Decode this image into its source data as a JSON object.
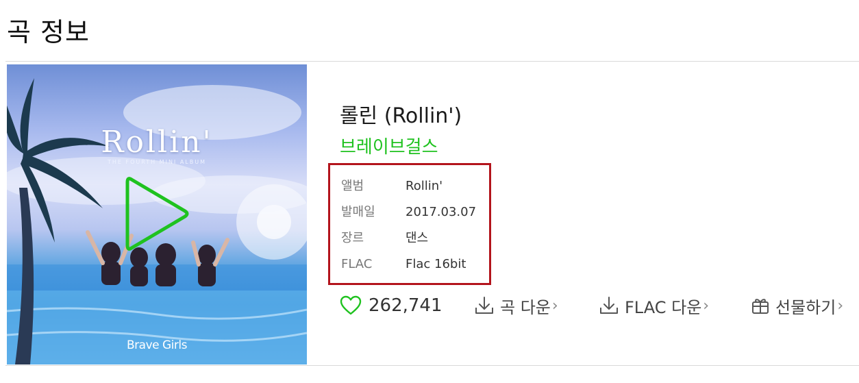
{
  "section": {
    "title": "곡 정보"
  },
  "album_art": {
    "title_text": "Rollin'",
    "subtitle_text": "THE FOURTH MINI ALBUM",
    "artist_text": "Brave Girls",
    "play_icon": "play-icon"
  },
  "song": {
    "title": "롤린 (Rollin')",
    "artist": "브레이브걸스"
  },
  "meta": [
    {
      "key": "앨범",
      "value": "Rollin'"
    },
    {
      "key": "발매일",
      "value": "2017.03.07"
    },
    {
      "key": "장르",
      "value": "댄스"
    },
    {
      "key": "FLAC",
      "value": "Flac 16bit"
    }
  ],
  "actions": {
    "like_icon": "heart-icon",
    "like_count": "262,741",
    "download": {
      "label": "곡 다운",
      "icon": "download-icon"
    },
    "flac_download": {
      "label": "FLAC 다운",
      "icon": "download-icon"
    },
    "gift": {
      "label": "선물하기",
      "icon": "gift-icon"
    },
    "chevron": "›"
  },
  "colors": {
    "accent": "#1fc21f",
    "highlight_border": "#b3141c"
  }
}
